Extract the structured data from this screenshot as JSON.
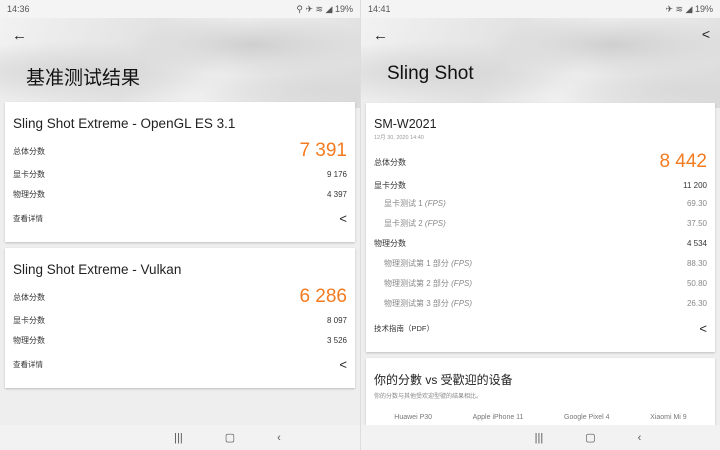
{
  "left": {
    "time": "14:36",
    "battery": "19%",
    "title": "基准测试结果",
    "cards": [
      {
        "title": "Sling Shot Extreme - OpenGL ES 3.1",
        "overall_label": "总体分数",
        "overall": "7 391",
        "gpu_label": "显卡分数",
        "gpu": "9 176",
        "phys_label": "物理分数",
        "phys": "4 397",
        "details": "查看详情"
      },
      {
        "title": "Sling Shot Extreme - Vulkan",
        "overall_label": "总体分数",
        "overall": "6 286",
        "gpu_label": "显卡分数",
        "gpu": "8 097",
        "phys_label": "物理分数",
        "phys": "3 526",
        "details": "查看详情"
      }
    ]
  },
  "right": {
    "time": "14:41",
    "battery": "19%",
    "title": "Sling Shot",
    "device": "SM-W2021",
    "date": "12月 30, 2020 14:40",
    "overall_label": "总体分数",
    "overall": "8 442",
    "gpu_label": "显卡分数",
    "gpu": "11 200",
    "gpu_tests": [
      {
        "label": "显卡测试 1",
        "unit": "(FPS)",
        "value": "69.30"
      },
      {
        "label": "显卡测试 2",
        "unit": "(FPS)",
        "value": "37.50"
      }
    ],
    "phys_label": "物理分数",
    "phys": "4 534",
    "phys_tests": [
      {
        "label": "物理测试第 1 部分",
        "unit": "(FPS)",
        "value": "88.30"
      },
      {
        "label": "物理测试第 2 部分",
        "unit": "(FPS)",
        "value": "50.80"
      },
      {
        "label": "物理测试第 3 部分",
        "unit": "(FPS)",
        "value": "26.30"
      }
    ],
    "guide": "技术指南（PDF）",
    "compare_title": "你的分數 vs 受歡迎的设备",
    "compare_sub": "你的分数与其他受欢迎型號的结果相比。",
    "devices": [
      "Huawei P30",
      "Apple iPhone 11",
      "Google Pixel 4",
      "Xiaomi Mi 9"
    ]
  },
  "accent": "#f47b20"
}
